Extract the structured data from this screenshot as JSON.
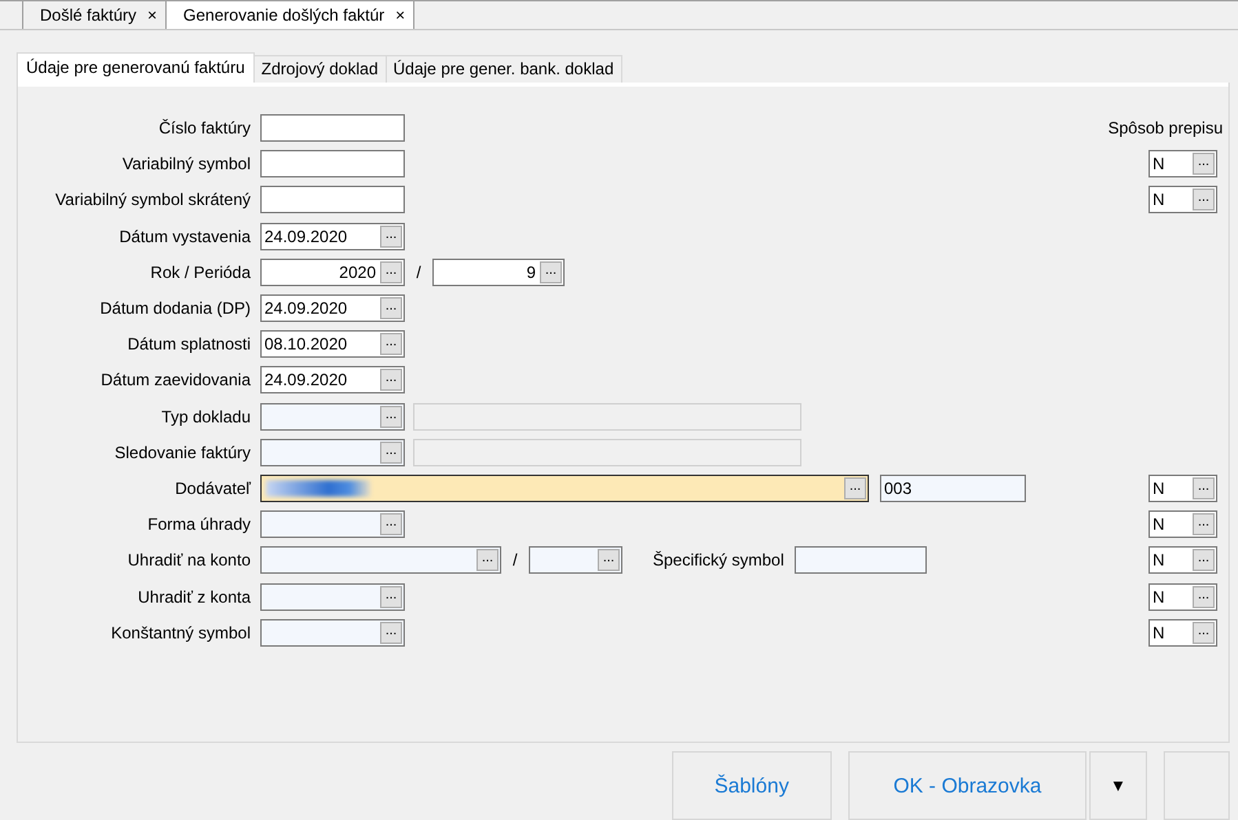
{
  "document_tabs": [
    {
      "label": "Došlé faktúry",
      "close": "×",
      "selected": false
    },
    {
      "label": "Generovanie došlých faktúr",
      "close": "×",
      "selected": true
    }
  ],
  "tabs": [
    {
      "label": "Údaje pre generovanú faktúru",
      "selected": true
    },
    {
      "label": "Zdrojový doklad",
      "selected": false
    },
    {
      "label": "Údaje pre gener. bank. doklad",
      "selected": false
    }
  ],
  "override_header": "Spôsob prepisu",
  "rows": [
    {
      "label": "Číslo faktúry",
      "fields": [
        {
          "kind": "text",
          "tinted": false
        }
      ]
    },
    {
      "label": "Variabilný symbol",
      "fields": [
        {
          "kind": "text",
          "tinted": false
        }
      ],
      "override": {
        "value": "N",
        "button": "..."
      }
    },
    {
      "label": "Variabilný symbol skrátený",
      "fields": [
        {
          "kind": "text",
          "tinted": false
        }
      ],
      "override": {
        "value": "N",
        "button": "..."
      }
    },
    {
      "label": "Dátum vystavenia",
      "fields": [
        {
          "kind": "date",
          "value": "24.09.2020",
          "button": "...",
          "tinted": false
        }
      ]
    },
    {
      "label": "Rok / Perióda",
      "fields": [
        {
          "kind": "number",
          "value": "2020",
          "button": "...",
          "tinted": false
        },
        {
          "kind": "separator",
          "text": "/"
        },
        {
          "kind": "period",
          "value": "9",
          "button": "...",
          "tinted": false
        }
      ]
    },
    {
      "label": "Dátum dodania (DP)",
      "fields": [
        {
          "kind": "date",
          "value": "24.09.2020",
          "button": "...",
          "tinted": false
        }
      ]
    },
    {
      "label": "Dátum splatnosti",
      "fields": [
        {
          "kind": "date",
          "value": "08.10.2020",
          "button": "...",
          "tinted": false
        }
      ]
    },
    {
      "label": "Dátum zaevidovania",
      "fields": [
        {
          "kind": "date",
          "value": "24.09.2020",
          "button": "...",
          "tinted": false
        }
      ]
    },
    {
      "label": "Typ dokladu",
      "fields": [
        {
          "kind": "date",
          "button": "...",
          "tinted": true
        },
        {
          "kind": "description"
        }
      ]
    },
    {
      "label": "Sledovanie faktúry",
      "fields": [
        {
          "kind": "date",
          "button": "...",
          "tinted": true
        },
        {
          "kind": "description"
        }
      ]
    },
    {
      "label": "Dodávateľ",
      "fields": [
        {
          "kind": "supplier",
          "redacted": true,
          "button": "...",
          "tinted": false
        },
        {
          "kind": "code",
          "value": "003",
          "tinted": true
        }
      ],
      "override": {
        "value": "N",
        "button": "..."
      }
    },
    {
      "label": "Forma úhrady",
      "fields": [
        {
          "kind": "date",
          "button": "...",
          "tinted": true
        }
      ],
      "override": {
        "value": "N",
        "button": "..."
      }
    },
    {
      "label": "Uhradiť na konto",
      "fields": [
        {
          "kind": "account",
          "button": "...",
          "tinted": true
        },
        {
          "kind": "separator",
          "text": "/"
        },
        {
          "kind": "bank",
          "button": "...",
          "tinted": true
        },
        {
          "kind": "label",
          "text": "Špecifický symbol"
        },
        {
          "kind": "symbol",
          "tinted": true
        }
      ],
      "override": {
        "value": "N",
        "button": "..."
      }
    },
    {
      "label": "Uhradiť z konta",
      "fields": [
        {
          "kind": "date",
          "button": "...",
          "tinted": true
        }
      ],
      "override": {
        "value": "N",
        "button": "..."
      }
    },
    {
      "label": "Konštantný symbol",
      "fields": [
        {
          "kind": "date",
          "button": "...",
          "tinted": true
        }
      ],
      "override": {
        "value": "N",
        "button": "..."
      }
    }
  ],
  "buttons": [
    {
      "kind": "action",
      "label": "Šablóny"
    },
    {
      "kind": "action",
      "label": "OK - Obrazovka"
    },
    {
      "kind": "dropdown",
      "label": "▼"
    },
    {
      "kind": "blank"
    }
  ]
}
